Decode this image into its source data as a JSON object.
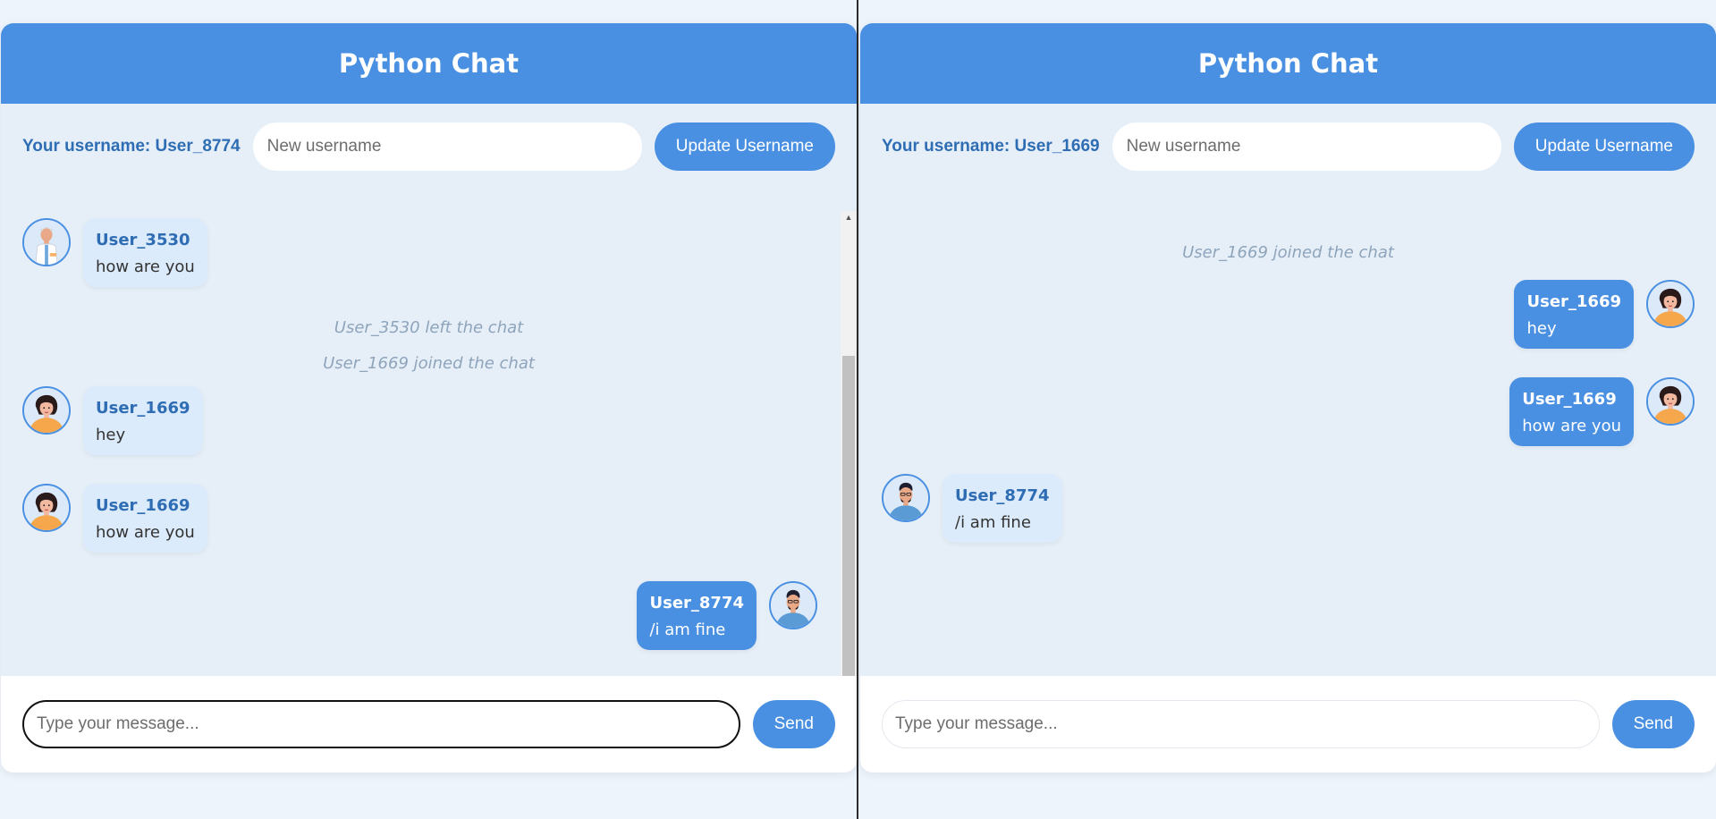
{
  "colors": {
    "accent": "#4a90e2",
    "label": "#2e6db4",
    "bubble_received": "#dcebfb",
    "system_text": "#8ea4bb"
  },
  "left": {
    "header_title": "Python Chat",
    "username_label": "Your username: User_8774",
    "username_placeholder": "New username",
    "update_button": "Update Username",
    "message_placeholder": "Type your message...",
    "send_button": "Send",
    "messages": [
      {
        "sender": "User_3530",
        "text": "how are you",
        "avatar": "doctor-avatar-icon"
      },
      {
        "system": "User_3530 left the chat"
      },
      {
        "system": "User_1669 joined the chat"
      },
      {
        "sender": "User_1669",
        "text": "hey",
        "avatar": "woman-avatar-icon"
      },
      {
        "sender": "User_1669",
        "text": "how are you",
        "avatar": "woman-avatar-icon"
      },
      {
        "sender": "User_8774",
        "text": "/i am fine",
        "avatar": "man-avatar-icon"
      }
    ]
  },
  "right": {
    "header_title": "Python Chat",
    "username_label": "Your username: User_1669",
    "username_placeholder": "New username",
    "update_button": "Update Username",
    "message_placeholder": "Type your message...",
    "send_button": "Send",
    "messages": [
      {
        "system": "User_1669 joined the chat"
      },
      {
        "sender": "User_1669",
        "text": "hey",
        "avatar": "woman-avatar-icon"
      },
      {
        "sender": "User_1669",
        "text": "how are you",
        "avatar": "woman-avatar-icon"
      },
      {
        "sender": "User_8774",
        "text": "/i am fine",
        "avatar": "man-avatar-icon"
      }
    ]
  }
}
